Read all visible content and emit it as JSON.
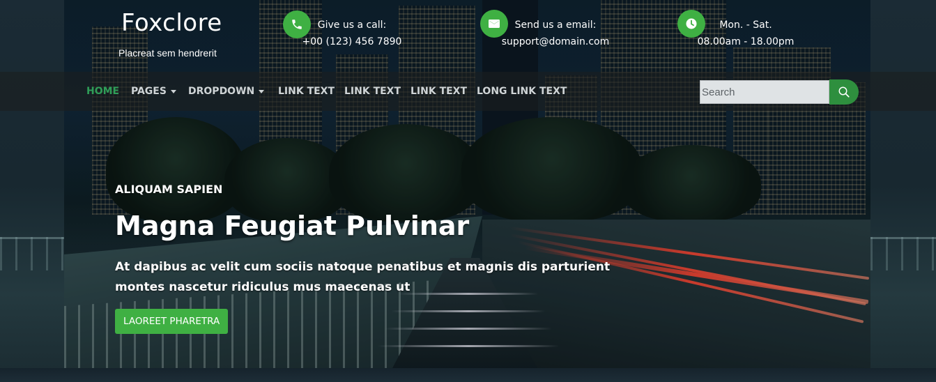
{
  "brand": {
    "title": "Foxclore",
    "tagline": "Placreat sem hendrerit"
  },
  "contact": [
    {
      "icon": "phone-icon",
      "label": "Give us a call:",
      "value": "+00 (123) 456 7890"
    },
    {
      "icon": "envelope-icon",
      "label": "Send us a email:",
      "value": "support@domain.com"
    },
    {
      "icon": "clock-icon",
      "label": "Mon. - Sat.",
      "value": "08.00am - 18.00pm"
    }
  ],
  "nav": {
    "items": [
      {
        "label": "HOME",
        "active": true
      },
      {
        "label": "PAGES",
        "dropdown": true
      },
      {
        "label": "DROPDOWN",
        "dropdown": true
      },
      {
        "label": "LINK TEXT"
      },
      {
        "label": "LINK TEXT"
      },
      {
        "label": "LINK TEXT"
      },
      {
        "label": "LONG LINK TEXT"
      }
    ],
    "search_placeholder": "Search",
    "search_icon": "search-icon"
  },
  "hero": {
    "eyebrow": "ALIQUAM SAPIEN",
    "title": "Magna Feugiat Pulvinar",
    "description": "At dapibus ac velit cum sociis natoque penatibus et magnis dis parturient montes nascetur ridiculus mus maecenas ut",
    "button_label": "LAOREET PHARETRA"
  },
  "colors": {
    "accent": "#3fb043",
    "active_nav": "#2f9e58",
    "search_button": "#2e8f3e"
  }
}
